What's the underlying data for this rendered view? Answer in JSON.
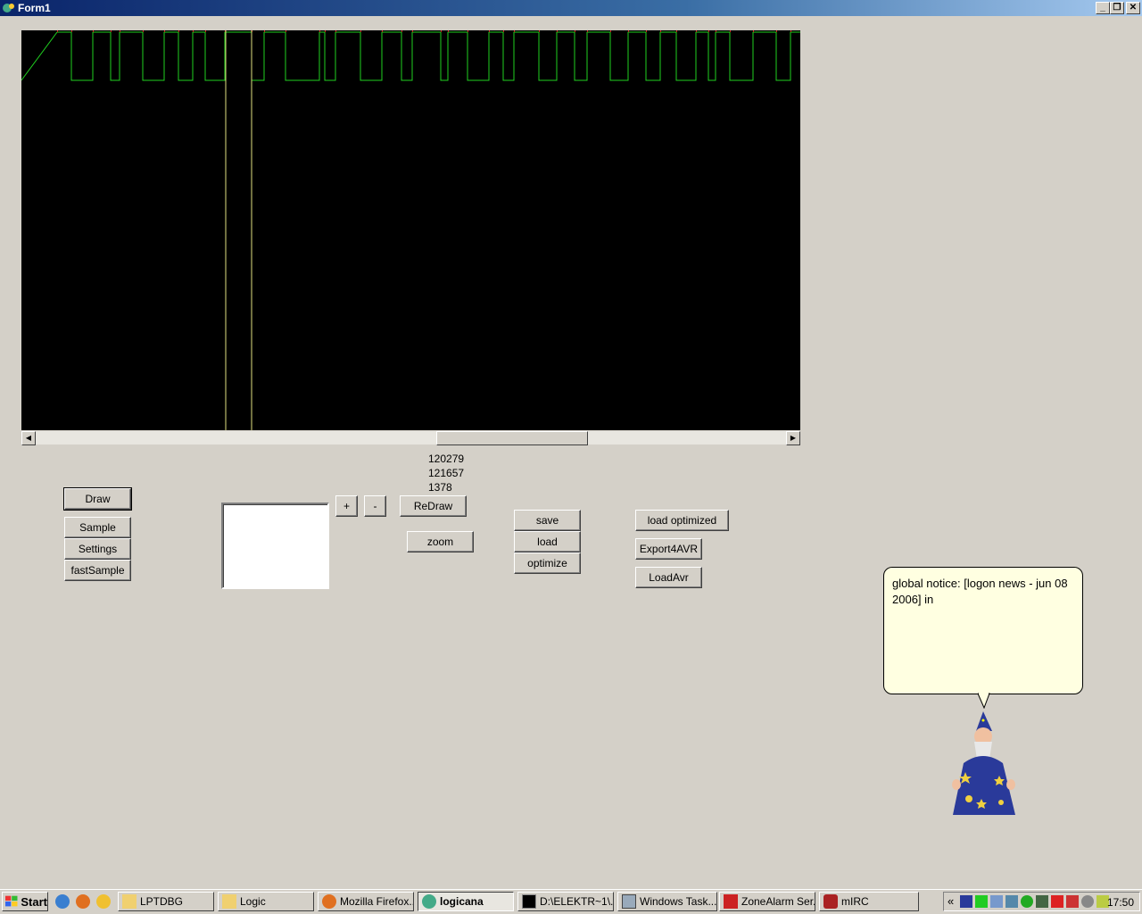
{
  "window": {
    "title": "Form1",
    "minimize": "_",
    "restore": "❐",
    "close": "✕"
  },
  "scrollbar": {
    "left_arrow": "◀",
    "right_arrow": "▶"
  },
  "readouts": {
    "line1": "120279",
    "line2": "121657",
    "line3": "1378"
  },
  "buttons": {
    "draw": "Draw",
    "sample": "Sample",
    "settings": "Settings",
    "fastsample": "fastSample",
    "plus": "+",
    "minus": "-",
    "redraw": "ReDraw",
    "zoom": "zoom",
    "save": "save",
    "load": "load",
    "optimize": "optimize",
    "load_optimized": "load optimized",
    "export4avr": "Export4AVR",
    "loadavr": "LoadAvr"
  },
  "balloon": {
    "text": "global notice: [logon news - jun 08 2006] in"
  },
  "taskbar": {
    "start": "Start",
    "tasks": [
      {
        "label": "LPTDBG",
        "icon": "folder-icon"
      },
      {
        "label": "Logic",
        "icon": "folder-icon"
      },
      {
        "label": "Mozilla Firefox...",
        "icon": "firefox-icon"
      },
      {
        "label": "logicana",
        "icon": "app-icon"
      },
      {
        "label": "D:\\ELEKTR~1\\...",
        "icon": "console-icon"
      },
      {
        "label": "Windows Task...",
        "icon": "taskmgr-icon"
      },
      {
        "label": "ZoneAlarm Ser...",
        "icon": "zonealarm-icon"
      },
      {
        "label": "mIRC",
        "icon": "mirc-icon"
      }
    ],
    "tray_chevron": "«",
    "clock": "17:50"
  },
  "colors": {
    "trace": "#20d020",
    "trace_edge": "#d02020",
    "cursor": "#e0e080",
    "desktop": "#d4d0c8"
  }
}
